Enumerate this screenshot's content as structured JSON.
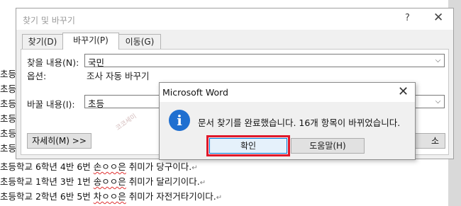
{
  "document": {
    "truncated_prefixes": [
      "초등",
      "초등",
      "초등",
      "초등",
      "초등",
      "초등"
    ],
    "lines": [
      {
        "pre": "초등학교 6학년 4반 6번 ",
        "name": "손ㅇㅇ은",
        "post": " 취미가 당구이다.",
        "mark": "↵"
      },
      {
        "pre": "초등학교 1학년 3반 1번 ",
        "name": "송ㅇㅇ은",
        "post": " 취미가 달리기이다.",
        "mark": "↵"
      },
      {
        "pre": "초등학교 2학년 6반 5번 ",
        "name": "차ㅇㅇ은",
        "post": " 취미가 자전거타기이다.",
        "mark": "↵"
      }
    ]
  },
  "find_replace": {
    "title": "찾기 및 바꾸기",
    "help": "?",
    "close": "✕",
    "tabs": [
      "찾기(D)",
      "바꾸기(P)",
      "이동(G)"
    ],
    "active_tab": 1,
    "find_label": "찾을 내용(N):",
    "find_value": "국민",
    "options_label": "옵션:",
    "options_value": "조사 자동 바꾸기",
    "replace_label": "바꿀 내용(I):",
    "replace_value": "초등",
    "more_button": "자세히(M) >>",
    "right_button_partial": "소"
  },
  "message_box": {
    "title": "Microsoft Word",
    "close": "✕",
    "icon": "info-icon",
    "message": "문서 찾기를 완료했습니다. 16개 항목이 바뀌었습니다.",
    "ok_label": "확인",
    "help_label": "도움말(H)"
  },
  "watermark_text": "코코세미",
  "colors": {
    "highlight_border": "#e0182a",
    "info_icon": "#1f6fd0",
    "ok_button_border": "#0078d7"
  }
}
